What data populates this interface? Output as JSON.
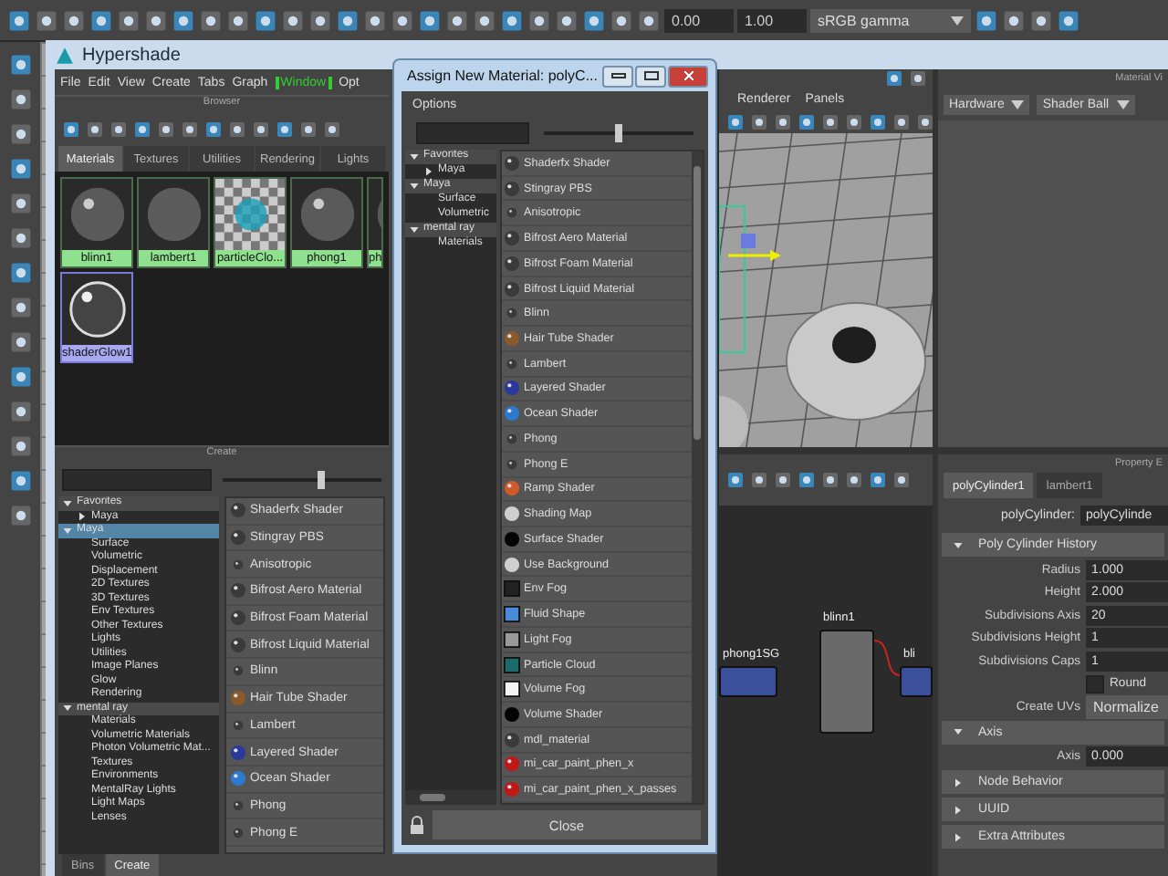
{
  "maya_toolbar": {
    "fields": [
      "0.00",
      "1.00"
    ],
    "color_space": "sRGB gamma"
  },
  "hypershade": {
    "title": "Hypershade",
    "menu": [
      {
        "label": "File",
        "highlighted": false
      },
      {
        "label": "Edit",
        "highlighted": false
      },
      {
        "label": "View",
        "highlighted": false
      },
      {
        "label": "Create",
        "highlighted": false
      },
      {
        "label": "Tabs",
        "highlighted": false
      },
      {
        "label": "Graph",
        "highlighted": false
      },
      {
        "label": "Window",
        "highlighted": true
      },
      {
        "label": "Opt",
        "highlighted": false
      }
    ],
    "browser": {
      "header": "Browser",
      "tabs": [
        {
          "label": "Materials",
          "selected": true
        },
        {
          "label": "Textures",
          "selected": false
        },
        {
          "label": "Utilities",
          "selected": false
        },
        {
          "label": "Rendering",
          "selected": false
        },
        {
          "label": "Lights",
          "selected": false
        }
      ],
      "swatches": [
        {
          "label": "blinn1",
          "kind": "sphere",
          "selected": false
        },
        {
          "label": "lambert1",
          "kind": "matte",
          "selected": false
        },
        {
          "label": "particleClo...",
          "kind": "checker",
          "selected": false
        },
        {
          "label": "phong1",
          "kind": "sphere",
          "selected": false
        },
        {
          "label": "ph",
          "kind": "sphere",
          "selected": false
        },
        {
          "label": "shaderGlow1",
          "kind": "glow",
          "selected": true
        }
      ]
    },
    "create": {
      "header": "Create",
      "slider": {
        "level": 0.62
      },
      "tree": [
        {
          "label": "Favorites",
          "expanded": true,
          "selected": false,
          "children": [
            {
              "label": "Maya",
              "expanded": false,
              "selected": false
            }
          ]
        },
        {
          "label": "Maya",
          "expanded": true,
          "selected": true,
          "children": [
            {
              "label": "Surface",
              "selected": false
            },
            {
              "label": "Volumetric",
              "selected": false
            },
            {
              "label": "Displacement",
              "selected": false
            },
            {
              "label": "2D Textures",
              "selected": false
            },
            {
              "label": "3D Textures",
              "selected": false
            },
            {
              "label": "Env Textures",
              "selected": false
            },
            {
              "label": "Other Textures",
              "selected": false
            },
            {
              "label": "Lights",
              "selected": false
            },
            {
              "label": "Utilities",
              "selected": false
            },
            {
              "label": "Image Planes",
              "selected": false
            },
            {
              "label": "Glow",
              "selected": false
            },
            {
              "label": "Rendering",
              "selected": false
            }
          ]
        },
        {
          "label": "mental ray",
          "expanded": true,
          "selected": false,
          "children": [
            {
              "label": "Materials",
              "selected": false
            },
            {
              "label": "Volumetric Materials",
              "selected": false
            },
            {
              "label": "Photon Volumetric Mat...",
              "selected": false
            },
            {
              "label": "Textures",
              "selected": false
            },
            {
              "label": "Environments",
              "selected": false
            },
            {
              "label": "MentalRay Lights",
              "selected": false
            },
            {
              "label": "Light Maps",
              "selected": false
            },
            {
              "label": "Lenses",
              "selected": false
            }
          ]
        }
      ],
      "list": [
        {
          "label": "Shaderfx Shader",
          "kind": "sphere"
        },
        {
          "label": "Stingray PBS",
          "kind": "sphere"
        },
        {
          "label": "Anisotropic",
          "kind": "dot"
        },
        {
          "label": "Bifrost Aero Material",
          "kind": "sphere"
        },
        {
          "label": "Bifrost Foam Material",
          "kind": "sphere"
        },
        {
          "label": "Bifrost Liquid Material",
          "kind": "sphere"
        },
        {
          "label": "Blinn",
          "kind": "dot"
        },
        {
          "label": "Hair Tube Shader",
          "kind": "hair"
        },
        {
          "label": "Lambert",
          "kind": "dot"
        },
        {
          "label": "Layered Shader",
          "kind": "layered"
        },
        {
          "label": "Ocean Shader",
          "kind": "ocean"
        },
        {
          "label": "Phong",
          "kind": "dot"
        },
        {
          "label": "Phong E",
          "kind": "dot"
        }
      ]
    },
    "bottom_tabs": [
      {
        "label": "Bins",
        "selected": false
      },
      {
        "label": "Create",
        "selected": true
      }
    ],
    "viewport": {
      "menu": [
        "Renderer",
        "Panels"
      ]
    },
    "material_viewer": {
      "header": "Material Vi",
      "renderer": "Hardware",
      "geometry": "Shader Ball"
    },
    "node_editor": {
      "nodes": [
        {
          "label": "phong1SG",
          "kind": "shading-group"
        },
        {
          "label": "blinn1",
          "kind": "material"
        },
        {
          "label": "bli",
          "kind": "shading-group"
        }
      ]
    },
    "property_editor": {
      "header": "Property E",
      "tabs": [
        {
          "label": "polyCylinder1",
          "selected": true
        },
        {
          "label": "lambert1",
          "selected": false
        }
      ],
      "node_label": "polyCylinder:",
      "node_value": "polyCylinde",
      "sections": [
        {
          "title": "Poly Cylinder History",
          "expanded": true,
          "rows": [
            {
              "kind": "field",
              "label": "Radius",
              "value": "1.000"
            },
            {
              "kind": "field",
              "label": "Height",
              "value": "2.000"
            },
            {
              "kind": "field",
              "label": "Subdivisions Axis",
              "value": "20"
            },
            {
              "kind": "field",
              "label": "Subdivisions Height",
              "value": "1"
            },
            {
              "kind": "field",
              "label": "Subdivisions Caps",
              "value": "1"
            },
            {
              "kind": "checkbox",
              "label": "Round",
              "checked": false
            },
            {
              "kind": "dropdown",
              "label": "Create UVs",
              "value": "Normalize"
            }
          ]
        },
        {
          "title": "Axis",
          "expanded": true,
          "rows": [
            {
              "kind": "field",
              "label": "Axis",
              "value": "0.000"
            }
          ]
        },
        {
          "title": "Node Behavior",
          "expanded": false
        },
        {
          "title": "UUID",
          "expanded": false
        },
        {
          "title": "Extra Attributes",
          "expanded": false
        }
      ]
    }
  },
  "dialog": {
    "title": "Assign New Material: polyC...",
    "menu": [
      "Options"
    ],
    "slider": {
      "level": 0.5
    },
    "tree": [
      {
        "label": "Favorites",
        "expanded": true,
        "selected": false,
        "children": [
          {
            "label": "Maya",
            "expanded": false,
            "selected": false
          }
        ]
      },
      {
        "label": "Maya",
        "expanded": true,
        "selected": false,
        "children": [
          {
            "label": "Surface",
            "selected": false
          },
          {
            "label": "Volumetric",
            "selected": false
          }
        ]
      },
      {
        "label": "mental ray",
        "expanded": true,
        "selected": false,
        "children": [
          {
            "label": "Materials",
            "selected": false
          }
        ]
      }
    ],
    "list": [
      {
        "label": "Shaderfx Shader",
        "kind": "sphere"
      },
      {
        "label": "Stingray PBS",
        "kind": "sphere"
      },
      {
        "label": "Anisotropic",
        "kind": "dot"
      },
      {
        "label": "Bifrost Aero Material",
        "kind": "sphere"
      },
      {
        "label": "Bifrost Foam Material",
        "kind": "sphere"
      },
      {
        "label": "Bifrost Liquid Material",
        "kind": "sphere"
      },
      {
        "label": "Blinn",
        "kind": "dot"
      },
      {
        "label": "Hair Tube Shader",
        "kind": "hair"
      },
      {
        "label": "Lambert",
        "kind": "dot"
      },
      {
        "label": "Layered Shader",
        "kind": "layered"
      },
      {
        "label": "Ocean Shader",
        "kind": "ocean"
      },
      {
        "label": "Phong",
        "kind": "dot"
      },
      {
        "label": "Phong E",
        "kind": "dot"
      },
      {
        "label": "Ramp Shader",
        "kind": "ramp"
      },
      {
        "label": "Shading Map",
        "kind": "flat-light"
      },
      {
        "label": "Surface Shader",
        "kind": "flat-dark"
      },
      {
        "label": "Use Background",
        "kind": "flat-light"
      },
      {
        "label": "Env Fog",
        "kind": "env-fog"
      },
      {
        "label": "Fluid Shape",
        "kind": "fluid"
      },
      {
        "label": "Light Fog",
        "kind": "light-fog"
      },
      {
        "label": "Particle Cloud",
        "kind": "particle"
      },
      {
        "label": "Volume Fog",
        "kind": "volume-fog"
      },
      {
        "label": "Volume Shader",
        "kind": "flat-dark"
      },
      {
        "label": "mdl_material",
        "kind": "sphere"
      },
      {
        "label": "mi_car_paint_phen_x",
        "kind": "paint"
      },
      {
        "label": "mi_car_paint_phen_x_passes",
        "kind": "paint"
      }
    ],
    "close_button": "Close"
  }
}
